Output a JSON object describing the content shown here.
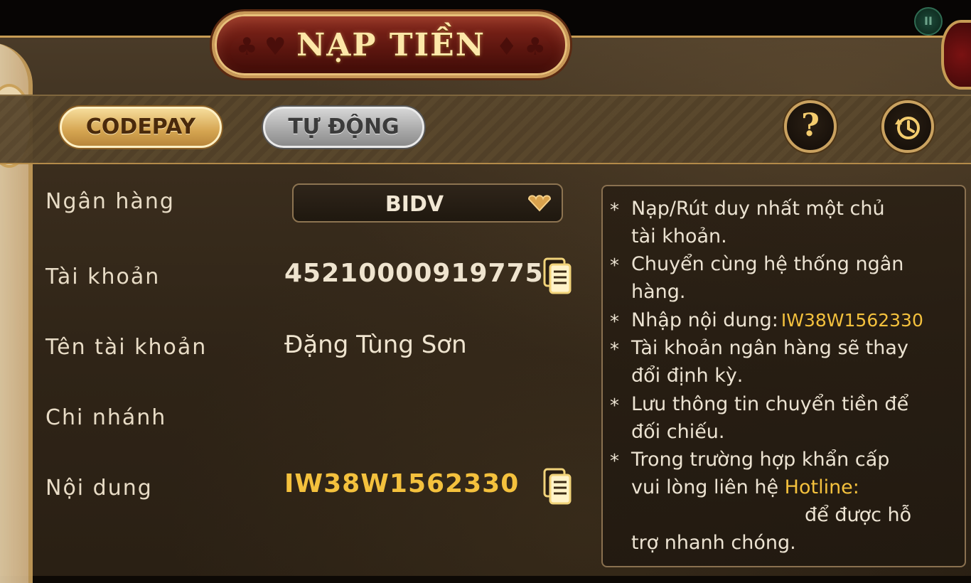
{
  "header": {
    "title": "NẠP TIỀN",
    "pause_label": "II"
  },
  "tabs": [
    {
      "label": "CODEPAY",
      "active": true
    },
    {
      "label": "TỰ ĐỘNG",
      "active": false
    }
  ],
  "buttons": {
    "help_label": "?",
    "help_icon": "question-icon",
    "history_icon": "history-icon"
  },
  "form": {
    "bank": {
      "label": "Ngân hàng",
      "value": "BIDV"
    },
    "account": {
      "label": "Tài khoản",
      "value": "45210000919775"
    },
    "account_name": {
      "label": "Tên tài khoản",
      "value": "Đặng Tùng Sơn"
    },
    "branch": {
      "label": "Chi nhánh",
      "value": ""
    },
    "content": {
      "label": "Nội dung",
      "value": "IW38W1562330"
    }
  },
  "notes": {
    "star": "*",
    "lines": [
      "Nạp/Rút duy nhất một chủ",
      "tài khoản.",
      "Chuyển cùng hệ thống ngân",
      "hàng.",
      "Nhập nội dung:",
      "Tài khoản ngân hàng sẽ thay",
      "đổi định kỳ.",
      "Lưu thông tin chuyển tiền để",
      "đối chiếu.",
      "Trong trường hợp khẩn cấp",
      "vui lòng liên hệ",
      "để được hỗ",
      "trợ nhanh chóng."
    ],
    "code": "IW38W1562330",
    "hotline_label": "Hotline:"
  },
  "colors": {
    "accent_gold": "#f4c13d",
    "title_red": "#8a2a1e",
    "border_gold": "#c99858"
  }
}
